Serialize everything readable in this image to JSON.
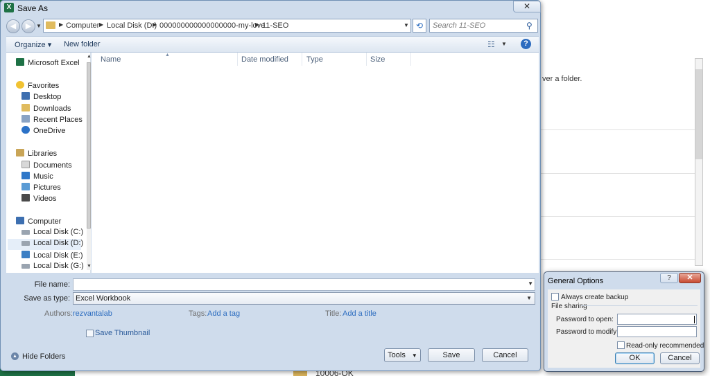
{
  "background": {
    "text": "ver a folder.",
    "bottom_item": "10006-OK"
  },
  "dialog": {
    "title": "Save As",
    "close_glyph": "✕",
    "title_icon": "X"
  },
  "address": {
    "crumbs": [
      "Computer",
      "Local Disk (D:)",
      "000000000000000000-my-love",
      "11-SEO"
    ],
    "search_placeholder": "Search 11-SEO"
  },
  "commands": {
    "organize": "Organize ▾",
    "new_folder": "New folder"
  },
  "nav": {
    "items": [
      {
        "label": "Microsoft Excel",
        "icon": "excel-icon"
      },
      {
        "label": "Favorites",
        "icon": "star-icon"
      },
      {
        "label": "Desktop",
        "icon": "desktop-icon"
      },
      {
        "label": "Downloads",
        "icon": "downloads-icon"
      },
      {
        "label": "Recent Places",
        "icon": "recent-places-icon"
      },
      {
        "label": "OneDrive",
        "icon": "onedrive-icon"
      },
      {
        "label": "Libraries",
        "icon": "libraries-icon"
      },
      {
        "label": "Documents",
        "icon": "documents-icon"
      },
      {
        "label": "Music",
        "icon": "music-icon"
      },
      {
        "label": "Pictures",
        "icon": "pictures-icon"
      },
      {
        "label": "Videos",
        "icon": "videos-icon"
      },
      {
        "label": "Computer",
        "icon": "computer-icon"
      },
      {
        "label": "Local Disk (C:)",
        "icon": "drive-icon"
      },
      {
        "label": "Local Disk (D:)",
        "icon": "drive-icon"
      },
      {
        "label": "Local Disk (E:)",
        "icon": "drive-icon"
      },
      {
        "label": "Local Disk (G:)",
        "icon": "drive-icon"
      }
    ]
  },
  "columns": [
    "Name",
    "Date modified",
    "Type",
    "Size"
  ],
  "form": {
    "filename_label": "File name:",
    "filename_value": "",
    "savetype_label": "Save as type:",
    "savetype_value": "Excel Workbook",
    "authors_label": "Authors:",
    "authors_value": "rezvantalab",
    "tags_label": "Tags:",
    "tags_value": "Add a tag",
    "title_label": "Title:",
    "title_value": "Add a title",
    "thumbnail_label": "Save Thumbnail"
  },
  "buttons": {
    "hide_folders": "Hide Folders",
    "tools": "Tools",
    "save": "Save",
    "cancel": "Cancel"
  },
  "general_options": {
    "title": "General Options",
    "help_glyph": "?",
    "close_glyph": "✕",
    "always_backup": "Always create backup",
    "file_sharing": "File sharing",
    "password_open_label": "Password to open:",
    "password_modify_label": "Password to modify:",
    "readonly_label": "Read-only recommended",
    "ok": "OK",
    "cancel": "Cancel"
  },
  "colors": {
    "excel_green": "#1e7145",
    "dialog_frame": "#cfdcec",
    "link_blue": "#2a6bbf"
  }
}
